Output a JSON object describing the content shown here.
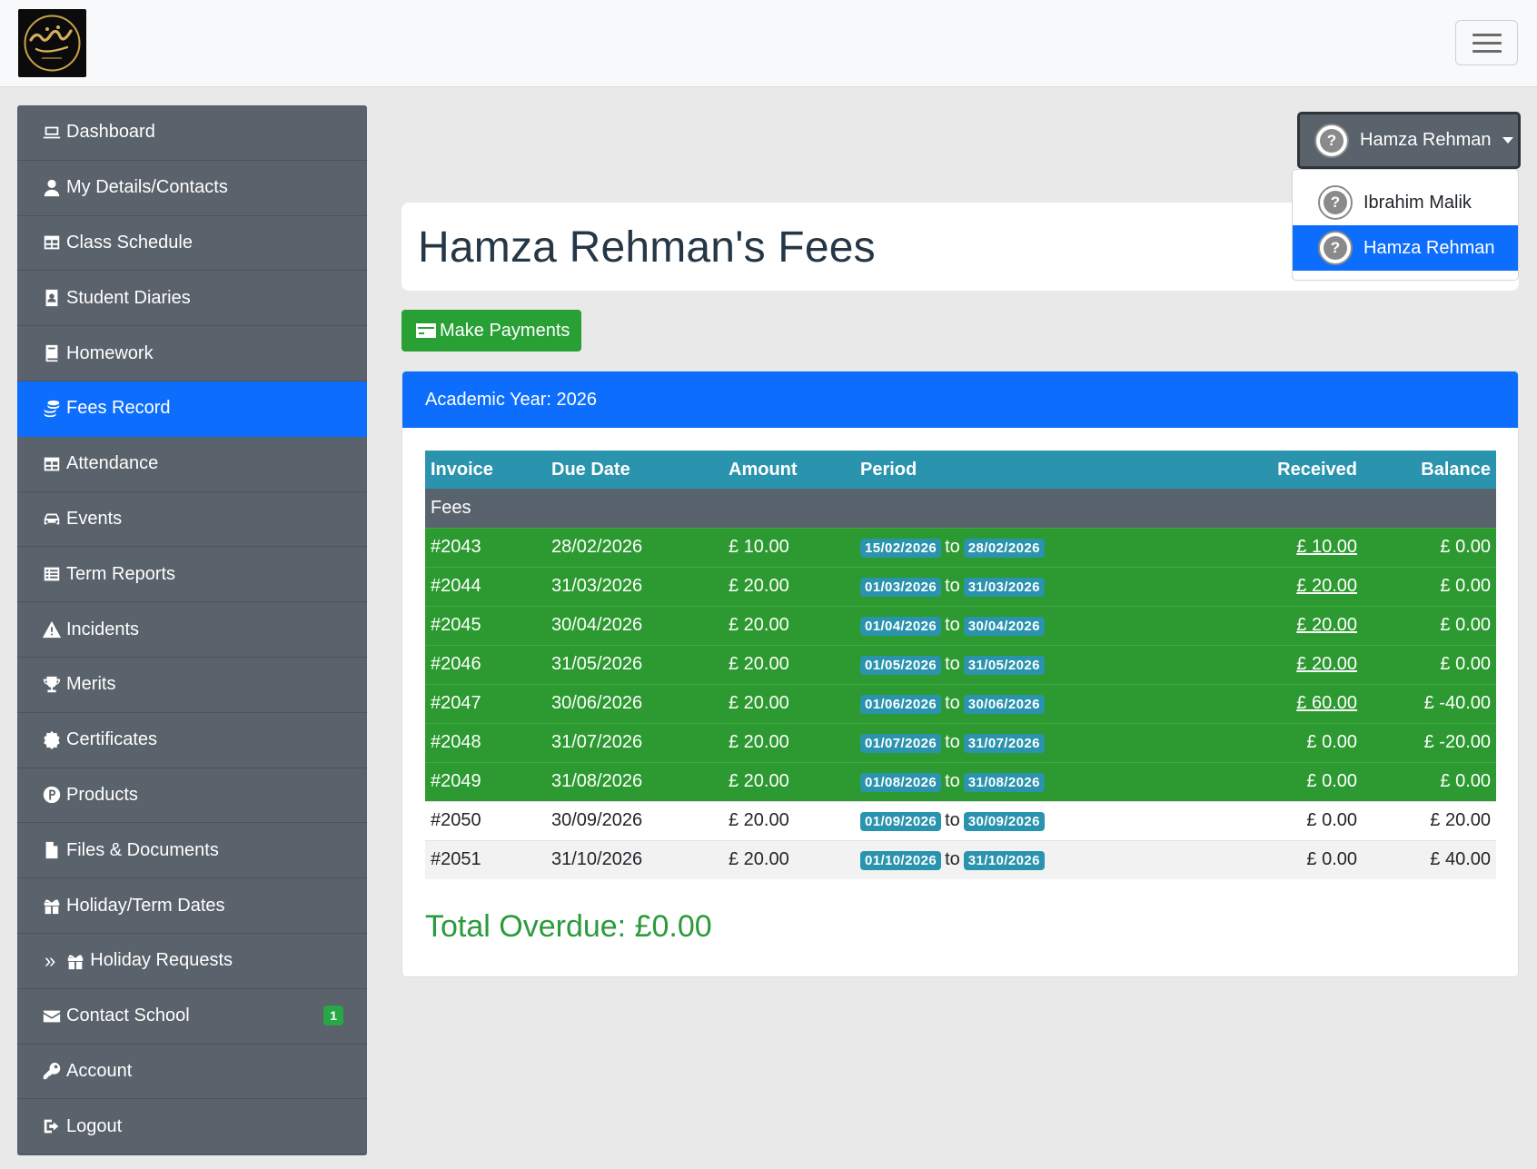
{
  "sidebar": {
    "items": [
      {
        "label": "Dashboard"
      },
      {
        "label": "My Details/Contacts"
      },
      {
        "label": "Class Schedule"
      },
      {
        "label": "Student Diaries"
      },
      {
        "label": "Homework"
      },
      {
        "label": "Fees Record"
      },
      {
        "label": "Attendance"
      },
      {
        "label": "Events"
      },
      {
        "label": "Term Reports"
      },
      {
        "label": "Incidents"
      },
      {
        "label": "Merits"
      },
      {
        "label": "Certificates"
      },
      {
        "label": "Products"
      },
      {
        "label": "Files & Documents"
      },
      {
        "label": "Holiday/Term Dates"
      },
      {
        "label": "Holiday Requests"
      },
      {
        "label": "Contact School",
        "badge": "1"
      },
      {
        "label": "Account"
      },
      {
        "label": "Logout"
      }
    ]
  },
  "user_menu": {
    "current": "Hamza Rehman",
    "options": [
      "Ibrahim Malik",
      "Hamza Rehman"
    ]
  },
  "page": {
    "title": "Hamza Rehman's Fees",
    "pay_button": "Make Payments",
    "academic_year": "Academic Year: 2026",
    "total_overdue": "Total Overdue: £0.00"
  },
  "table": {
    "headers": [
      "Invoice",
      "Due Date",
      "Amount",
      "Period",
      "Received",
      "Balance"
    ],
    "section": "Fees",
    "to_word": "to",
    "rows": [
      [
        "#2043",
        "28/02/2026",
        "£ 10.00",
        "15/02/2026",
        "28/02/2026",
        "£ 10.00",
        "£ 0.00"
      ],
      [
        "#2044",
        "31/03/2026",
        "£ 20.00",
        "01/03/2026",
        "31/03/2026",
        "£ 20.00",
        "£ 0.00"
      ],
      [
        "#2045",
        "30/04/2026",
        "£ 20.00",
        "01/04/2026",
        "30/04/2026",
        "£ 20.00",
        "£ 0.00"
      ],
      [
        "#2046",
        "31/05/2026",
        "£ 20.00",
        "01/05/2026",
        "31/05/2026",
        "£ 20.00",
        "£ 0.00"
      ],
      [
        "#2047",
        "30/06/2026",
        "£ 20.00",
        "01/06/2026",
        "30/06/2026",
        "£ 60.00",
        "£ -40.00"
      ],
      [
        "#2048",
        "31/07/2026",
        "£ 20.00",
        "01/07/2026",
        "31/07/2026",
        "£ 0.00",
        "£ -20.00"
      ],
      [
        "#2049",
        "31/08/2026",
        "£ 20.00",
        "01/08/2026",
        "31/08/2026",
        "£ 0.00",
        "£ 0.00"
      ],
      [
        "#2050",
        "30/09/2026",
        "£ 20.00",
        "01/09/2026",
        "30/09/2026",
        "£ 0.00",
        "£ 20.00"
      ],
      [
        "#2051",
        "31/10/2026",
        "£ 20.00",
        "01/10/2026",
        "31/10/2026",
        "£ 0.00",
        "£ 40.00"
      ]
    ]
  }
}
